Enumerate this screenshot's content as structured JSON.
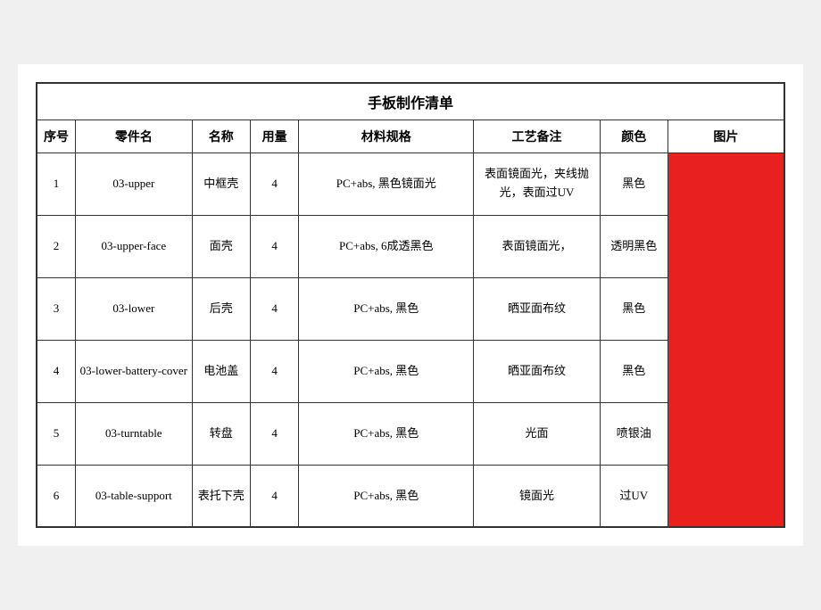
{
  "title": "手板制作清单",
  "headers": {
    "seq": "序号",
    "part_code": "零件名",
    "name": "名称",
    "qty": "用量",
    "spec": "材料规格",
    "process": "工艺备注",
    "color": "颜色",
    "image": "图片"
  },
  "rows": [
    {
      "seq": "1",
      "part_code": "03-upper",
      "name": "中框壳",
      "qty": "4",
      "spec": "PC+abs, 黑色镜面光",
      "process": "表面镜面光，夹线抛光，表面过UV",
      "color": "黑色"
    },
    {
      "seq": "2",
      "part_code": "03-upper-face",
      "name": "面壳",
      "qty": "4",
      "spec": "PC+abs, 6成透黑色",
      "process": "表面镜面光，",
      "color": "透明黑色"
    },
    {
      "seq": "3",
      "part_code": "03-lower",
      "name": "后壳",
      "qty": "4",
      "spec": "PC+abs, 黑色",
      "process": "晒亚面布纹",
      "color": "黑色"
    },
    {
      "seq": "4",
      "part_code": "03-lower-battery-cover",
      "name": "电池盖",
      "qty": "4",
      "spec": "PC+abs, 黑色",
      "process": "晒亚面布纹",
      "color": "黑色"
    },
    {
      "seq": "5",
      "part_code": "03-turntable",
      "name": "转盘",
      "qty": "4",
      "spec": "PC+abs, 黑色",
      "process": "光面",
      "color": "喷银油"
    },
    {
      "seq": "6",
      "part_code": "03-table-support",
      "name": "表托下壳",
      "qty": "4",
      "spec": "PC+abs, 黑色",
      "process": "镜面光",
      "color": "过UV"
    }
  ]
}
